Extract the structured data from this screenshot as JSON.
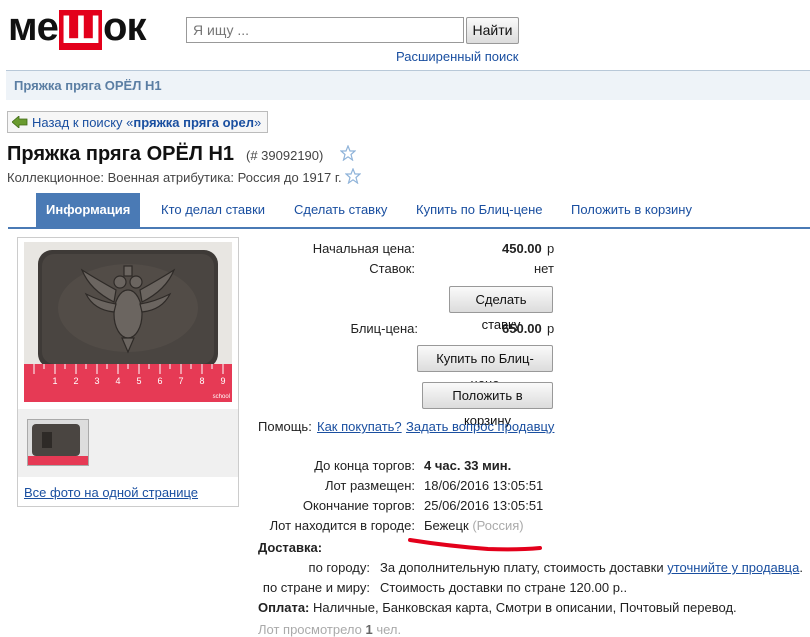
{
  "header": {
    "logo_pre": "ме",
    "logo_red": "Ш",
    "logo_post": "ок",
    "search_placeholder": "Я ищу ...",
    "search_button": "Найти",
    "advanced_search": "Расширенный поиск"
  },
  "breadcrumb_title": "Пряжка пряга ОРЁЛ Н1",
  "back": {
    "prefix": "Назад к поиску «",
    "query": "пряжка пряга орел",
    "suffix": "»"
  },
  "lot": {
    "title": "Пряжка пряга ОРЁЛ Н1",
    "number": "(# 39092190)",
    "category": "Коллекционное: Военная атрибутика: Россия до 1917 г."
  },
  "tabs": [
    "Информация",
    "Кто делал ставки",
    "Сделать ставку",
    "Купить по Блиц-цене",
    "Положить в корзину"
  ],
  "photos": {
    "all_link": "Все фото на одной странице",
    "ruler_digits": [
      "1",
      "2",
      "3",
      "4",
      "5",
      "6",
      "7",
      "8",
      "9"
    ],
    "ruler_brand": "school"
  },
  "info": {
    "start_price_label": "Начальная цена:",
    "start_price": "450.00",
    "currency": "р",
    "bids_label": "Ставок:",
    "bids": "нет",
    "bid_button": "Сделать ставку",
    "blitz_label": "Блиц-цена:",
    "blitz_price": "650.00",
    "blitz_button": "Купить по Блиц-цене",
    "cart_button": "Положить в корзину",
    "help_label": "Помощь:",
    "help_link1": "Как покупать?",
    "help_link2": "Задать вопрос продавцу",
    "until_end_label": "До конца торгов:",
    "until_end": "4 час. 33 мин.",
    "placed_label": "Лот размещен:",
    "placed": "18/06/2016 13:05:51",
    "ends_label": "Окончание торгов:",
    "ends": "25/06/2016 13:05:51",
    "city_label": "Лот находится в городе:",
    "city": "Бежецк",
    "country": "(Россия)",
    "delivery_label": "Доставка:",
    "city_deliv_label": "по городу:",
    "city_deliv": "За дополнительную плату, стоимость доставки ",
    "city_deliv_link": "уточнийте у продавца",
    "city_deliv_end": ".",
    "country_deliv_label": "по стране и миру:",
    "country_deliv": "Стоимость доставки по стране 120.00 р..",
    "payment_label": "Оплата:",
    "payment": "Наличные, Банковская карта, Смотри в описании, Почтовый перевод.",
    "views_pre": "Лот просмотрело ",
    "views_count": "1",
    "views_post": " чел."
  },
  "colors": {
    "accent": "#4a7ab5",
    "link": "#1a4fa0",
    "logo_red": "#e3001b",
    "underline_red": "#e3001b"
  }
}
